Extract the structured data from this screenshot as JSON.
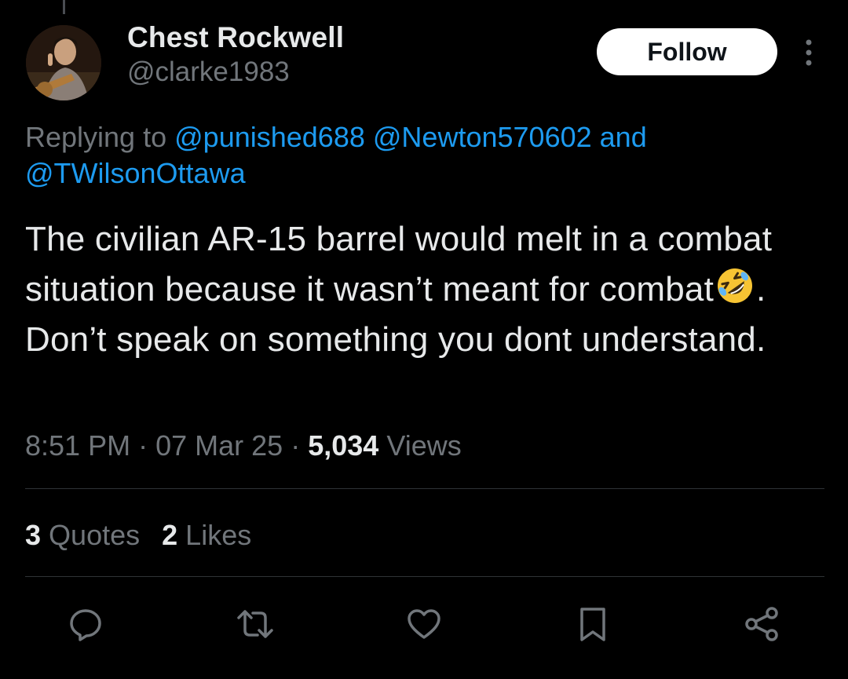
{
  "author": {
    "display_name": "Chest Rockwell",
    "handle": "@clarke1983"
  },
  "follow_button": {
    "label": "Follow"
  },
  "reply_context": {
    "prefix": "Replying to",
    "mentions": [
      "@punished688",
      "@Newton570602"
    ],
    "conjunction": "and",
    "last_mention": "@TWilsonOttawa"
  },
  "tweet": {
    "text_part1": "The civilian AR-15 barrel would melt in a combat situation because it wasn’t meant for combat",
    "emoji": "rolling-on-the-floor-laughing",
    "text_part2": ". Don’t speak on something you dont understand."
  },
  "meta": {
    "time": "8:51 PM",
    "separator": "·",
    "date": "07 Mar 25",
    "views_count": "5,034",
    "views_label": "Views"
  },
  "stats": {
    "quotes_count": "3",
    "quotes_label": "Quotes",
    "likes_count": "2",
    "likes_label": "Likes"
  },
  "actions": [
    "reply-icon",
    "repost-icon",
    "like-icon",
    "bookmark-icon",
    "share-icon"
  ],
  "colors": {
    "background": "#000000",
    "primary_text": "#e7e9ea",
    "secondary_text": "#71767b",
    "link": "#1d9bf0",
    "divider": "#2f3336",
    "follow_bg": "#ffffff"
  }
}
